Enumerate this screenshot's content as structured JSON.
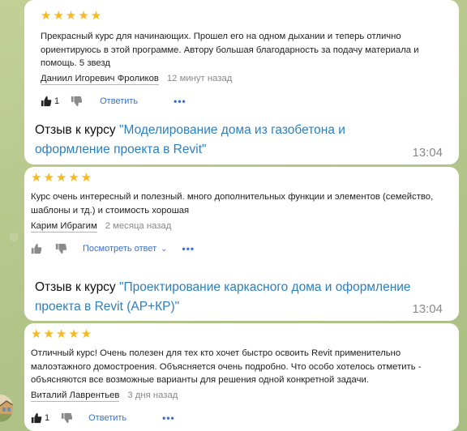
{
  "messages": [
    {
      "review": {
        "stars": "★★★★★",
        "text": "Прекрасный курс для начинающих. Прошел его на одном дыхании и теперь отлично ориентируюсь в этой программе. Автору большая благодарность за подачу материала и помощь. 5 звезд",
        "author": "Даниил Игоревич Фроликов",
        "time_ago": "12 минут назад",
        "likes": "1",
        "reply_label": "Ответить",
        "more": "•••"
      },
      "caption_prefix": "Отзыв к курсу ",
      "caption_link": "\"Моделирование дома из газобетона и оформление проекта в Revit\"",
      "time": "13:04"
    },
    {
      "review": {
        "stars": "★★★★★",
        "text": "Курс очень интересный и полезный. много дополнительных функции и элементов (семейство, шаблоны и тд.) и стоимость хорошая",
        "author": "Карим Ибрагим",
        "time_ago": "2 месяца назад",
        "reply_label": "Посмотреть ответ",
        "more": "•••"
      },
      "caption_prefix": "Отзыв к курсу ",
      "caption_link": "\"Проектирование каркасного дома и оформление проекта в Revit (АР+КР)\"",
      "time": "13:04"
    },
    {
      "review": {
        "stars": "★★★★★",
        "text": "Отличный курс! Очень полезен для тех кто хочет быстро освоить Revit применительно малоэтажного домостроения. Объясняется очень подробно. Что особо хотелось отметить - объясняются все возможные варианты для решения одной конкретной задачи.",
        "author": "Виталий Лаврентьев",
        "time_ago": "3 дня назад",
        "likes": "1",
        "reply_label": "Ответить",
        "more": "•••"
      }
    }
  ],
  "colors": {
    "star": "#f5b922",
    "link": "#2b7fc1",
    "action_link": "#3a6fcf",
    "background": "#b9c98e"
  }
}
